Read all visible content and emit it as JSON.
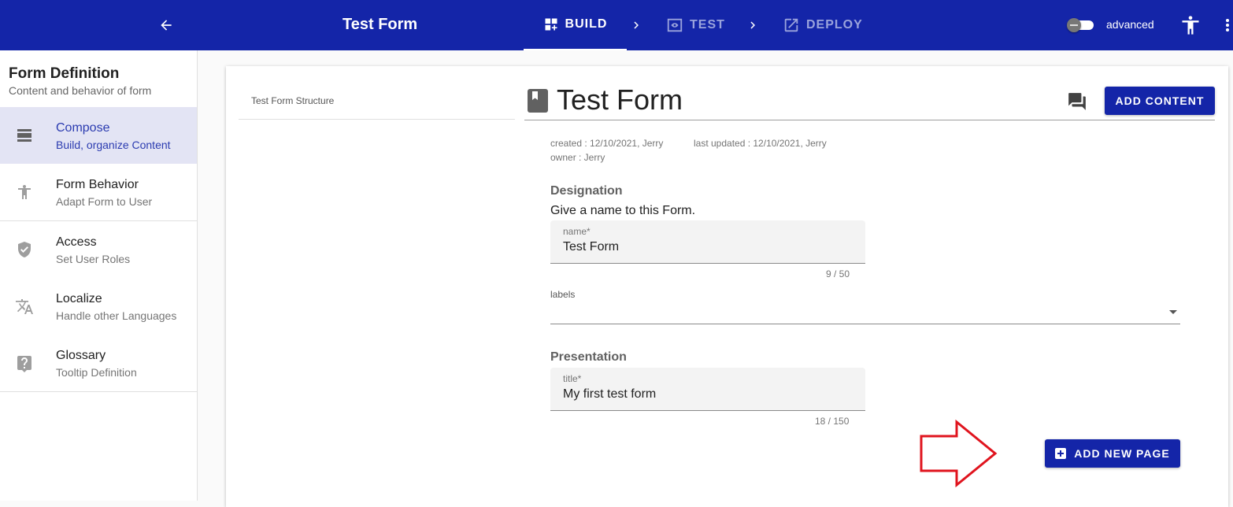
{
  "topbar": {
    "title": "Test Form",
    "steps": [
      {
        "label": "BUILD",
        "active": true
      },
      {
        "label": "TEST",
        "active": false
      },
      {
        "label": "DEPLOY",
        "active": false
      }
    ],
    "advanced_label": "advanced",
    "advanced_on": false
  },
  "sidebar": {
    "title": "Form Definition",
    "subtitle": "Content and behavior of form",
    "items": [
      {
        "label": "Compose",
        "sub": "Build, organize Content",
        "icon": "view-agenda-icon",
        "active": true
      },
      {
        "label": "Form Behavior",
        "sub": "Adapt Form to User",
        "icon": "accessibility-icon"
      },
      {
        "label": "Access",
        "sub": "Set User Roles",
        "icon": "shield-check-icon"
      },
      {
        "label": "Localize",
        "sub": "Handle other Languages",
        "icon": "translate-icon"
      },
      {
        "label": "Glossary",
        "sub": "Tooltip Definition",
        "icon": "help-box-icon"
      }
    ]
  },
  "main": {
    "structure_title": "Test Form Structure",
    "form_title": "Test Form",
    "add_content_label": "ADD CONTENT",
    "meta": {
      "created": "created : 12/10/2021, Jerry",
      "updated": "last updated : 12/10/2021, Jerry",
      "owner": "owner : Jerry"
    },
    "designation": {
      "heading": "Designation",
      "help": "Give a name to this Form.",
      "name_label": "name*",
      "name_value": "Test Form",
      "name_counter": "9 / 50",
      "labels_label": "labels"
    },
    "presentation": {
      "heading": "Presentation",
      "title_label": "title*",
      "title_value": "My first test form",
      "title_counter": "18 / 150"
    },
    "add_page_label": "ADD NEW PAGE"
  },
  "colors": {
    "primary": "#1425a8",
    "active_bg": "#e3e4f4",
    "annotation_arrow": "#e0141e"
  }
}
